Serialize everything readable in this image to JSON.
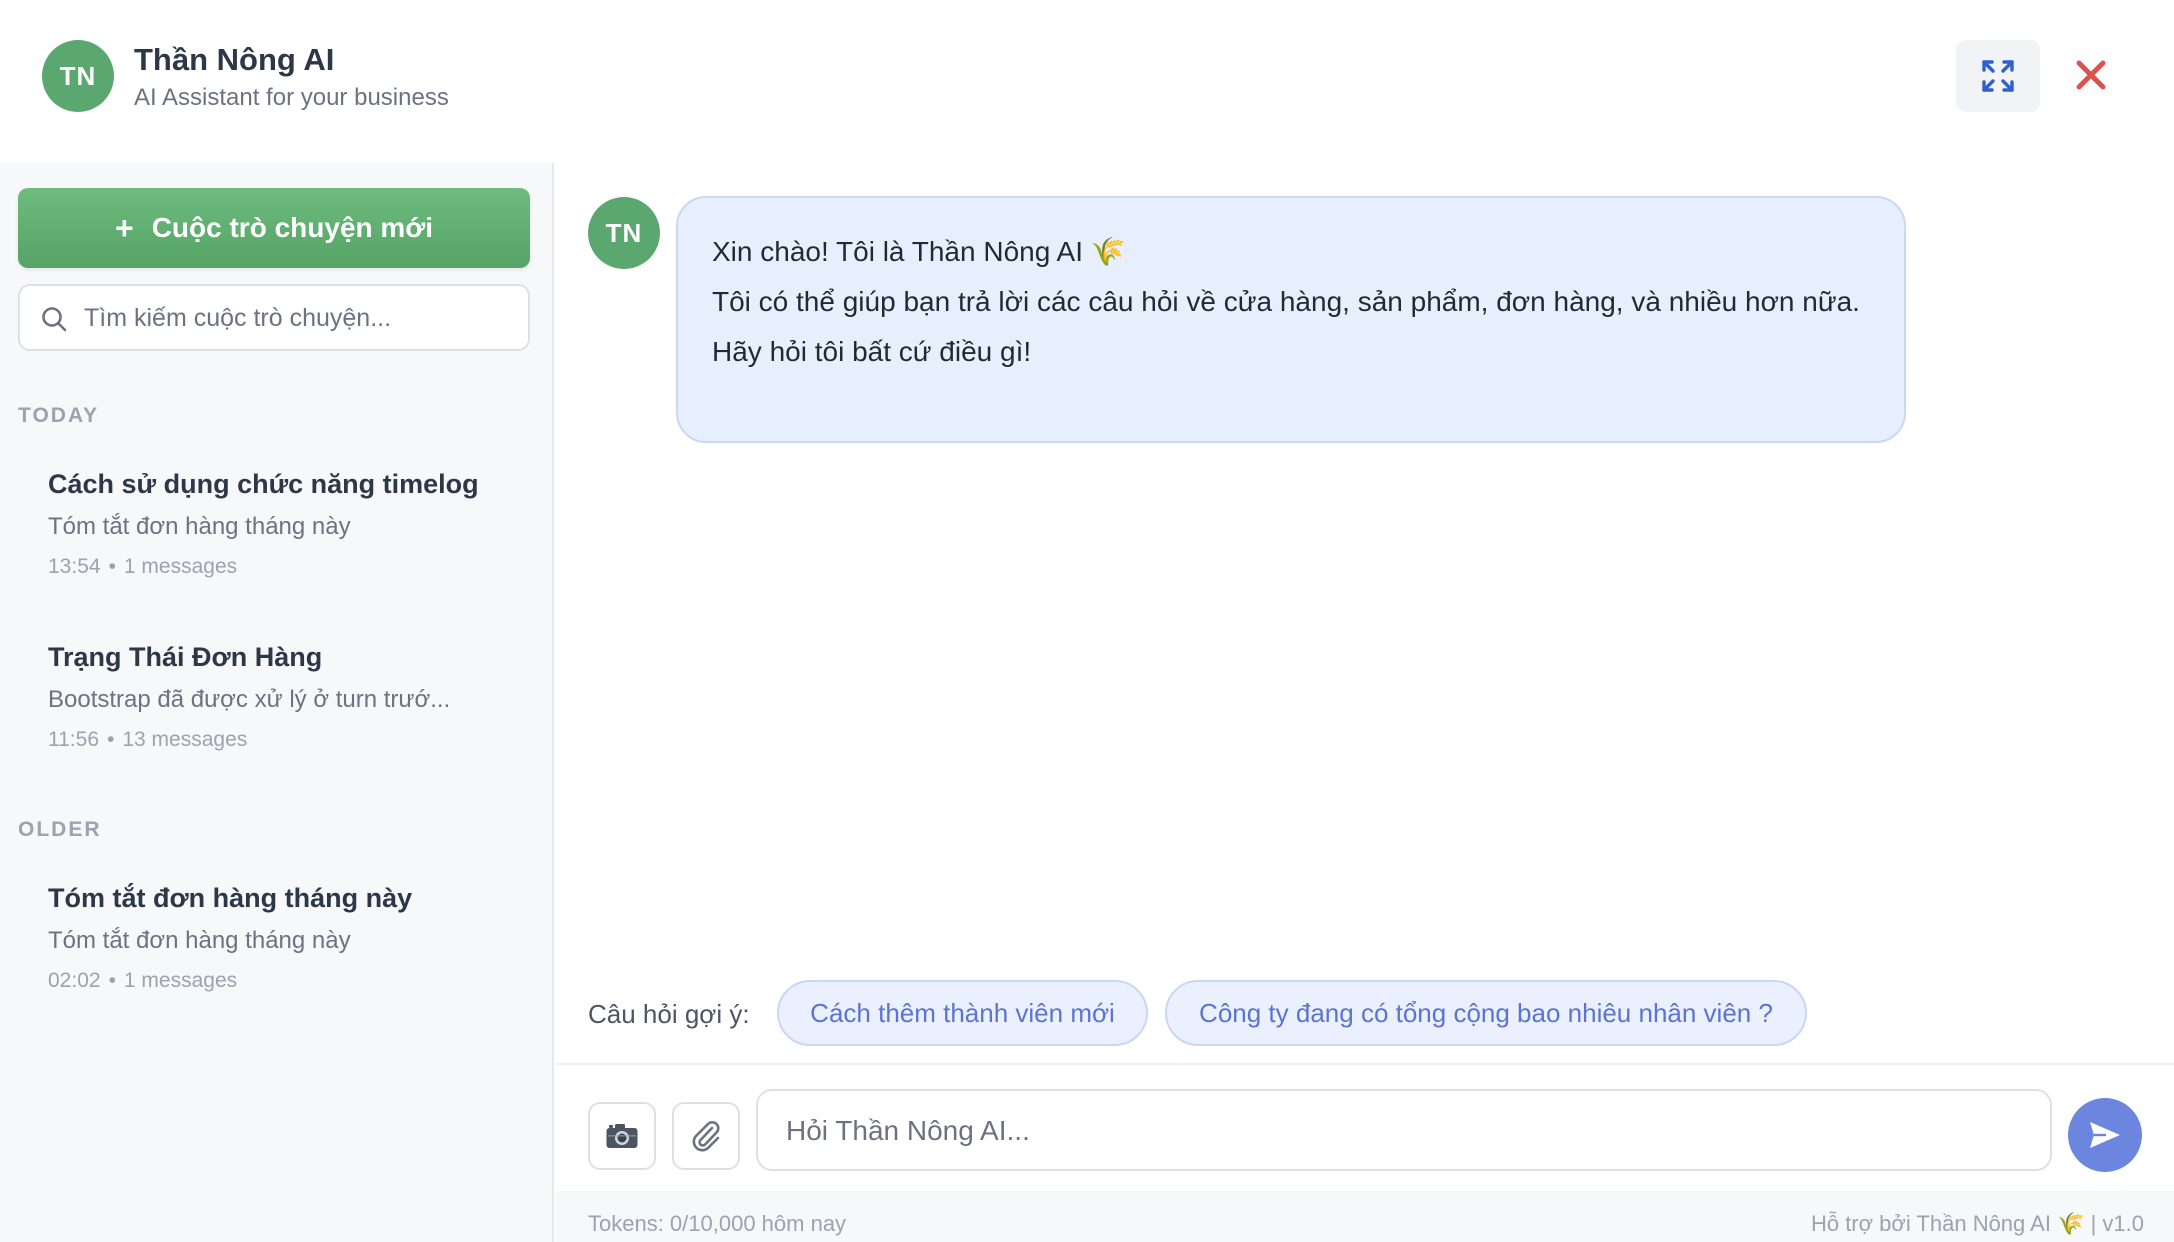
{
  "header": {
    "avatar_initials": "TN",
    "title": "Thần Nông AI",
    "subtitle": "AI Assistant for your business",
    "expand_icon": "expand-icon",
    "close_icon": "close-icon"
  },
  "sidebar": {
    "new_chat_label": "Cuộc trò chuyện mới",
    "search_placeholder": "Tìm kiếm cuộc trò chuyện...",
    "sections": [
      {
        "label": "TODAY",
        "conversations": [
          {
            "title": "Cách sử dụng chức năng timelog",
            "preview": "Tóm tắt đơn hàng tháng này",
            "time": "13:54",
            "count": "1 messages"
          },
          {
            "title": "Trạng Thái Đơn Hàng",
            "preview": "Bootstrap đã được xử lý ở turn trướ...",
            "time": "11:56",
            "count": "13 messages"
          }
        ]
      },
      {
        "label": "OLDER",
        "conversations": [
          {
            "title": "Tóm tắt đơn hàng tháng này",
            "preview": "Tóm tắt đơn hàng tháng này",
            "time": "02:02",
            "count": "1 messages"
          }
        ]
      }
    ]
  },
  "chat": {
    "bot_initials": "TN",
    "welcome": {
      "line1": "Xin chào! Tôi là Thần Nông AI 🌾",
      "line2": "Tôi có thể giúp bạn trả lời các câu hỏi về cửa hàng, sản phẩm, đơn hàng, và nhiều hơn nữa.",
      "line3": "Hãy hỏi tôi bất cứ điều gì!"
    },
    "suggest_label": "Câu hỏi gợi ý:",
    "suggestions": [
      "Cách thêm thành viên mới",
      "Công ty đang có tổng cộng bao nhiêu nhân viên ?"
    ],
    "input_placeholder": "Hỏi Thần Nông AI...",
    "tokens_text": "Tokens: 0/10,000 hôm nay",
    "powered_text": "Hỗ trợ bởi Thần Nông AI 🌾 | v1.0"
  },
  "colors": {
    "brand_green": "#5aa870",
    "accent_blue": "#6c86e0",
    "close_red": "#d9534f"
  }
}
